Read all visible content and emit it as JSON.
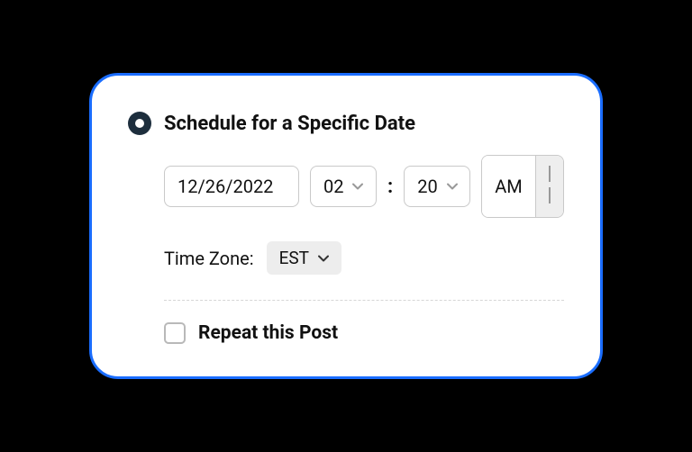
{
  "schedule": {
    "radio_label": "Schedule for a Specific Date",
    "date": "12/26/2022",
    "hour": "02",
    "minute": "20",
    "colon": ":",
    "ampm_active": "AM",
    "ampm_inactive_icon": "pause"
  },
  "timezone": {
    "label": "Time Zone:",
    "value": "EST"
  },
  "repeat": {
    "label": "Repeat this Post",
    "checked": false
  }
}
